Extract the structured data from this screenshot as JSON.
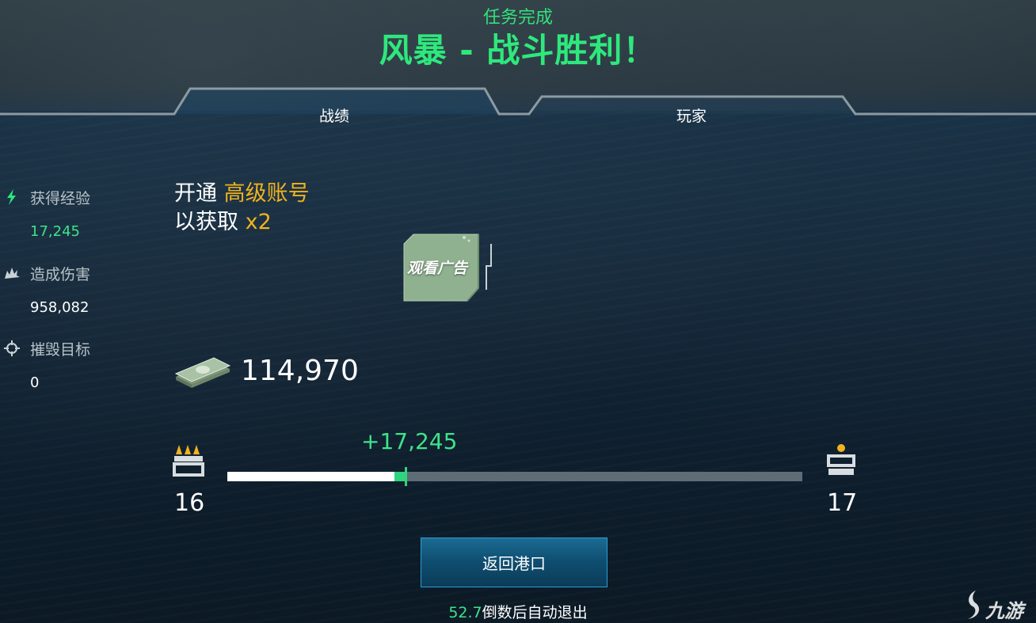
{
  "header": {
    "subtitle": "任务完成",
    "title": "风暴 - 战斗胜利！"
  },
  "tabs": [
    {
      "label": "战绩",
      "active": true
    },
    {
      "label": "玩家",
      "active": false
    }
  ],
  "stats": [
    {
      "icon": "lightning-icon",
      "label": "获得经验",
      "value": "17,245",
      "value_color": "#3ee38a"
    },
    {
      "icon": "explosion-icon",
      "label": "造成伤害",
      "value": "958,082",
      "value_color": "#ffffff"
    },
    {
      "icon": "crosshair-icon",
      "label": "摧毁目标",
      "value": "0",
      "value_color": "#ffffff"
    }
  ],
  "promo": {
    "line1_prefix": "开通 ",
    "line1_highlight": "高级账号",
    "line2_prefix": "以获取 ",
    "line2_highlight": "x2"
  },
  "ad_button": {
    "label": "观看广告"
  },
  "currency": {
    "icon": "cash-stack-icon",
    "value": "114,970"
  },
  "progress": {
    "gain_label": "+17,245",
    "previous_fraction": 0.29,
    "current_fraction": 0.31,
    "current_rank": "16",
    "next_rank": "17"
  },
  "return_button": {
    "label": "返回港口"
  },
  "countdown": {
    "seconds": "52.7",
    "text": "倒数后自动退出"
  },
  "watermark": {
    "text": "九游"
  },
  "colors": {
    "accent_green": "#2ee87c",
    "gold": "#f0b21e",
    "button_blue": "#1c6b93"
  }
}
